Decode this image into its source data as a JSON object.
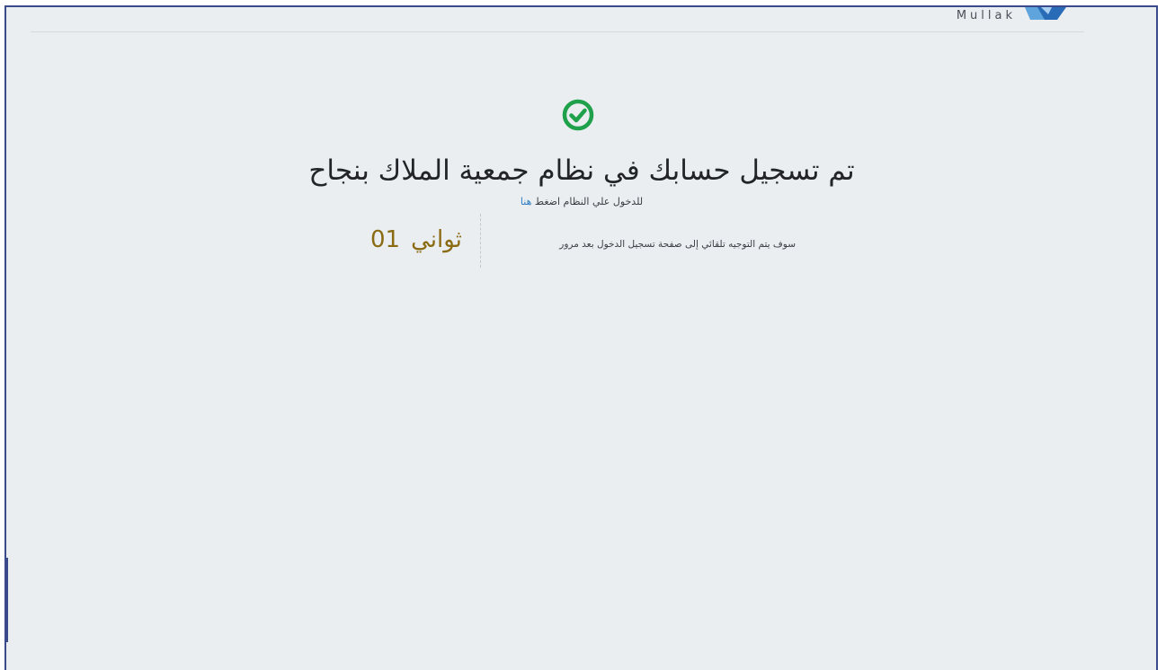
{
  "brand": {
    "name": "Mullak",
    "logo_colors": [
      "#2a6bb8",
      "#5fa4dd"
    ]
  },
  "success": {
    "icon": "check-circle-icon",
    "icon_color": "#1fa04a",
    "title": "تم تسجيل حسابك في نظام جمعية الملاك بنجاح",
    "login_prompt": "للدخول علي النظام اضغط",
    "login_link": "هنا",
    "redirect_text": "سوف يتم التوجيه تلقائي إلى صفحة تسجيل الدخول بعد مرور",
    "countdown_value": "01",
    "countdown_unit": "ثواني",
    "countdown_color": "#8a6a12"
  }
}
